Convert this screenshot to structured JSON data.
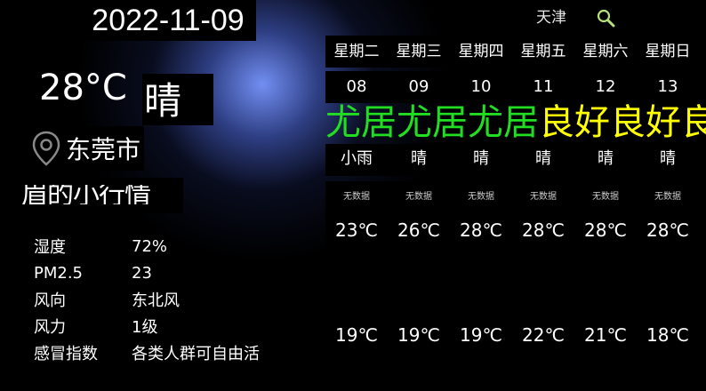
{
  "main": {
    "date": "2022-11-09",
    "temp": "28°C",
    "weather": "晴",
    "location": "东莞市",
    "scroll_text": "眉的小行情"
  },
  "details": [
    {
      "label": "湿度",
      "value": "72%"
    },
    {
      "label": "PM2.5",
      "value": "23"
    },
    {
      "label": "风向",
      "value": "东北风"
    },
    {
      "label": "风力",
      "value": "1级"
    },
    {
      "label": "感冒指数",
      "value": "各类人群可自由活"
    }
  ],
  "search": {
    "city": "天津"
  },
  "icons": {
    "location": "location-pin-icon",
    "search": "search-icon"
  },
  "marquee": {
    "green_text": "尤居尤居尤居",
    "yellow_text": "良好良好良好"
  },
  "forecast": [
    {
      "day": "星期二",
      "date": "08",
      "weather": "小雨",
      "aqi": "无数据",
      "high": "23℃",
      "low": "19℃"
    },
    {
      "day": "星期三",
      "date": "09",
      "weather": "晴",
      "aqi": "无数据",
      "high": "26℃",
      "low": "19℃"
    },
    {
      "day": "星期四",
      "date": "10",
      "weather": "晴",
      "aqi": "无数据",
      "high": "28℃",
      "low": "19℃"
    },
    {
      "day": "星期五",
      "date": "11",
      "weather": "晴",
      "aqi": "无数据",
      "high": "28℃",
      "low": "22℃"
    },
    {
      "day": "星期六",
      "date": "12",
      "weather": "晴",
      "aqi": "无数据",
      "high": "28℃",
      "low": "21℃"
    },
    {
      "day": "星期日",
      "date": "13",
      "weather": "晴",
      "aqi": "无数据",
      "high": "28℃",
      "low": "18℃"
    }
  ],
  "colors": {
    "background": "#000000",
    "glow": "#7896ff",
    "good": "#22dd22",
    "moderate": "#ffff00"
  }
}
